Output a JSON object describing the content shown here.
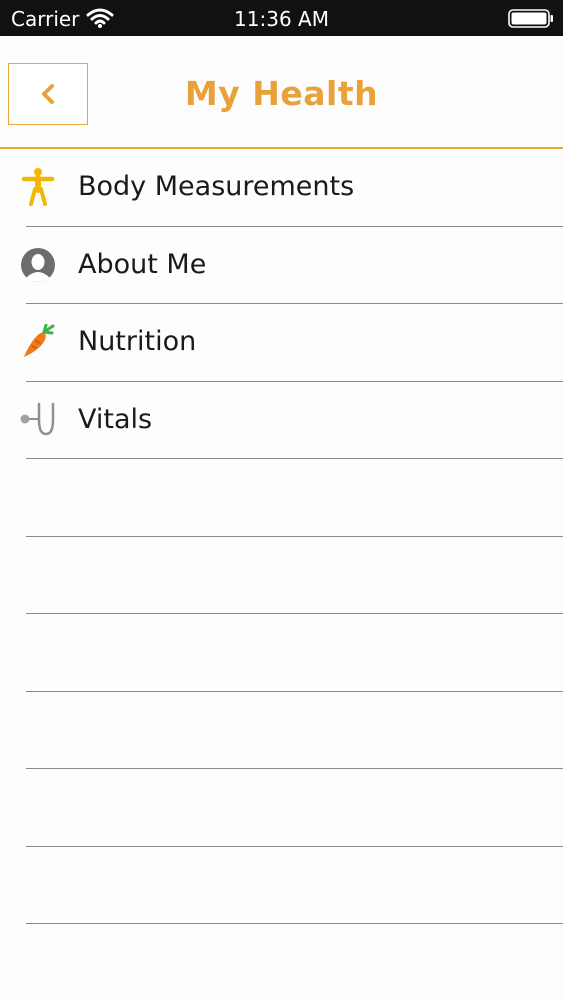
{
  "status_bar": {
    "carrier": "Carrier",
    "time": "11:36 AM"
  },
  "header": {
    "title": "My Health",
    "back_icon": "chevron-left-icon",
    "accent_color": "#e9a13a"
  },
  "menu": {
    "items": [
      {
        "label": "Body Measurements",
        "icon": "body-figure-icon"
      },
      {
        "label": "About Me",
        "icon": "person-silhouette-icon"
      },
      {
        "label": "Nutrition",
        "icon": "carrot-icon"
      },
      {
        "label": "Vitals",
        "icon": "stethoscope-icon"
      }
    ],
    "empty_rows": 7
  }
}
